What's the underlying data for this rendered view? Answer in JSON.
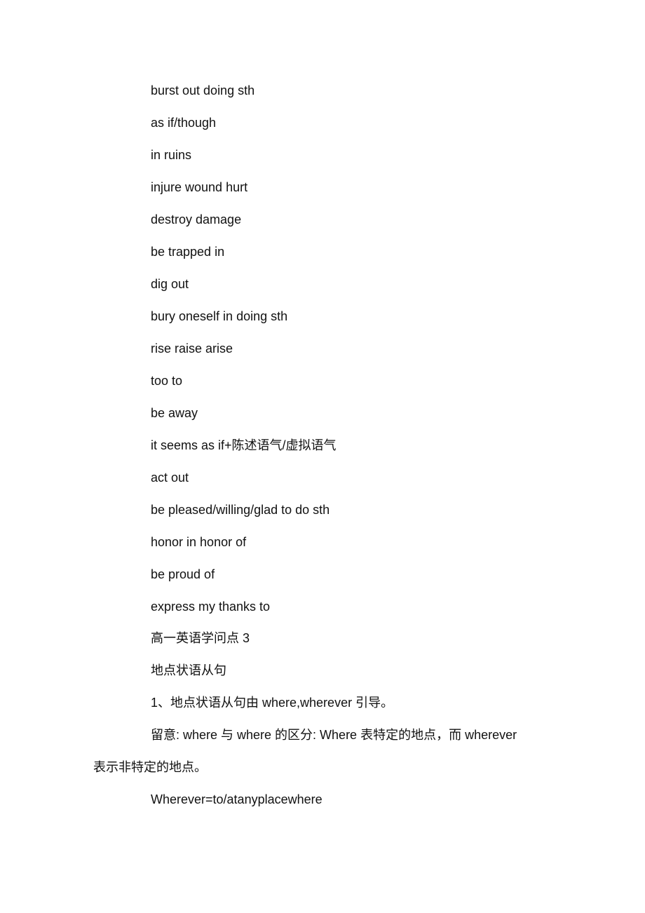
{
  "document": {
    "phrases": [
      "burst out doing sth",
      "as if/though",
      "in ruins",
      "injure wound hurt",
      "destroy damage",
      "be trapped in",
      "dig out",
      "bury oneself in doing sth",
      "rise raise arise",
      "too to",
      "be away",
      "it seems as if+陈述语气/虚拟语气",
      "act out",
      "be pleased/willing/glad to do sth",
      "honor in honor of",
      "be proud of",
      "express my thanks to"
    ],
    "section_title": "高一英语学问点 3",
    "subsection_title": "地点状语从句",
    "point_1": "1、地点状语从句由 where,wherever 引导。",
    "note_line_1": "留意: where 与 where 的区分: Where 表特定的地点，而 wherever",
    "note_line_2": "表示非特定的地点。",
    "formula": "Wherever=to/atanyplacewhere"
  }
}
